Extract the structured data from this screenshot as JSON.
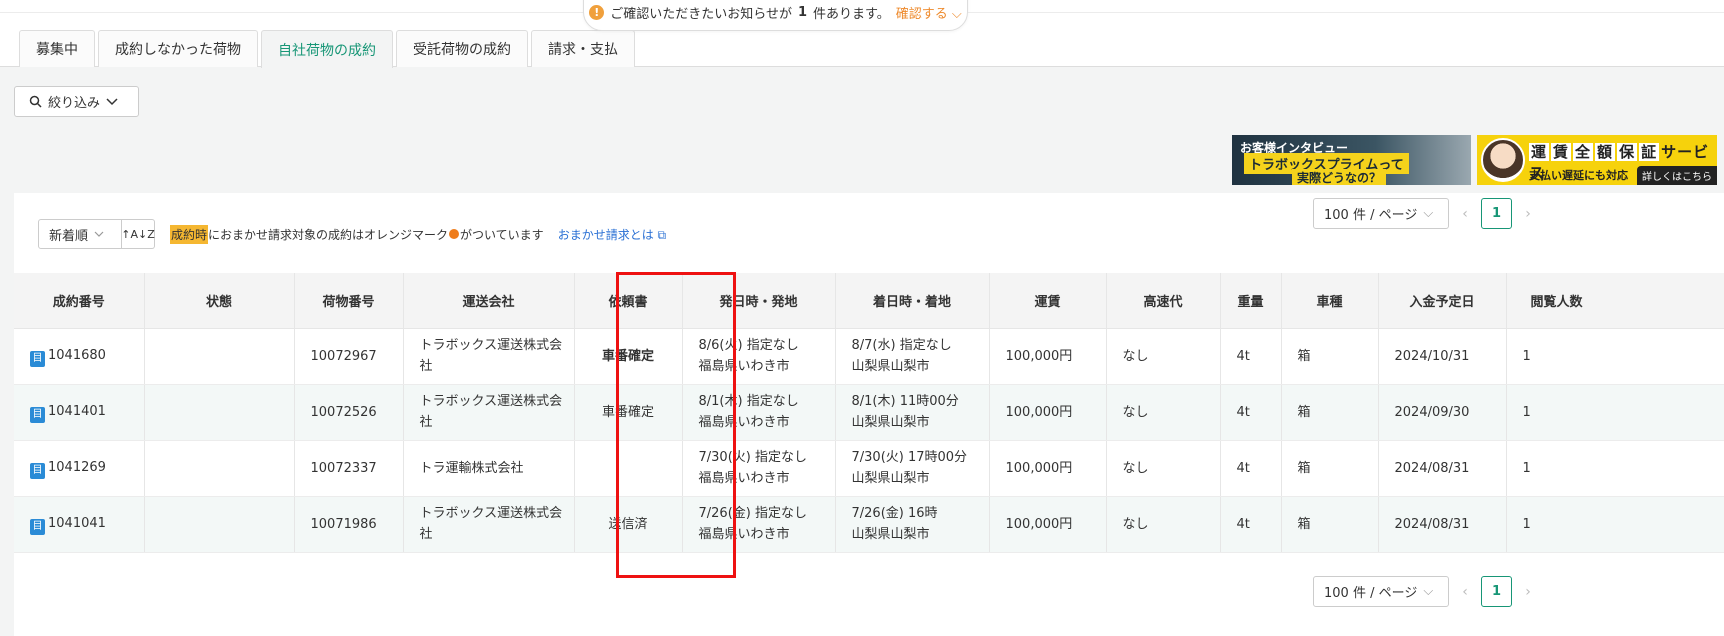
{
  "notice": {
    "prefix": "ご確認いただきたいお知らせが",
    "count": "1",
    "suffix": "件あります。",
    "confirm": "確認する"
  },
  "tabs": [
    {
      "label": "募集中"
    },
    {
      "label": "成約しなかった荷物"
    },
    {
      "label": "自社荷物の成約"
    },
    {
      "label": "受託荷物の成約"
    },
    {
      "label": "請求・支払"
    }
  ],
  "filter": {
    "label": "絞り込み"
  },
  "banners": {
    "interview": {
      "line1": "お客様インタビュー",
      "line2": "トラボックスプライムって",
      "line3": "実際どうなの？"
    },
    "guarantee": {
      "chars": [
        "運",
        "賃",
        "全",
        "額",
        "保",
        "証"
      ],
      "service": "サービス",
      "sub": "支払い遅延にも対応",
      "more": "詳しくはこちら"
    }
  },
  "toolbar": {
    "sort": "新着順",
    "sort_dir": "↑A↓Z",
    "note_highlight": "成約時",
    "note_mid": "におまかせ請求対象の成約はオレンジマーク",
    "note_end": "がついています",
    "link": "おまかせ請求とは"
  },
  "pagination": {
    "per_page": "100 件 / ページ",
    "page": "1",
    "prev": "‹",
    "next": "›"
  },
  "table": {
    "headers": [
      "成約番号",
      "状態",
      "荷物番号",
      "運送会社",
      "依頼書",
      "発日時・発地",
      "着日時・着地",
      "運賃",
      "高速代",
      "重量",
      "車種",
      "入金予定日",
      "閲覧人数"
    ],
    "rows": [
      {
        "id": "1041680",
        "status": "",
        "cargo": "10072967",
        "carrier": "トラボックス運送株式会社",
        "request": "車番確定",
        "dep_time": "8/6(火) 指定なし",
        "dep_place": "福島県いわき市",
        "arr_time": "8/7(水) 指定なし",
        "arr_place": "山梨県山梨市",
        "fare": "100,000円",
        "toll": "なし",
        "weight": "4t",
        "vehicle": "箱",
        "pay_date": "2024/10/31",
        "views": "1"
      },
      {
        "id": "1041401",
        "status": "",
        "cargo": "10072526",
        "carrier": "トラボックス運送株式会社",
        "request": "車番確定",
        "dep_time": "8/1(木) 指定なし",
        "dep_place": "福島県いわき市",
        "arr_time": "8/1(木) 11時00分",
        "arr_place": "山梨県山梨市",
        "fare": "100,000円",
        "toll": "なし",
        "weight": "4t",
        "vehicle": "箱",
        "pay_date": "2024/09/30",
        "views": "1"
      },
      {
        "id": "1041269",
        "status": "",
        "cargo": "10072337",
        "carrier": "トラ運輸株式会社",
        "request": "",
        "dep_time": "7/30(火) 指定なし",
        "dep_place": "福島県いわき市",
        "arr_time": "7/30(火) 17時00分",
        "arr_place": "山梨県山梨市",
        "fare": "100,000円",
        "toll": "なし",
        "weight": "4t",
        "vehicle": "箱",
        "pay_date": "2024/08/31",
        "views": "1"
      },
      {
        "id": "1041041",
        "status": "",
        "cargo": "10071986",
        "carrier": "トラボックス運送株式会社",
        "request": "送信済",
        "dep_time": "7/26(金) 指定なし",
        "dep_place": "福島県いわき市",
        "arr_time": "7/26(金) 16時",
        "arr_place": "山梨県山梨市",
        "fare": "100,000円",
        "toll": "なし",
        "weight": "4t",
        "vehicle": "箱",
        "pay_date": "2024/08/31",
        "views": "1"
      }
    ]
  },
  "colors": {
    "accent": "#179676",
    "orange": "#ef7c1a",
    "link": "#2a70d4",
    "highlight_box": "#e11111"
  }
}
